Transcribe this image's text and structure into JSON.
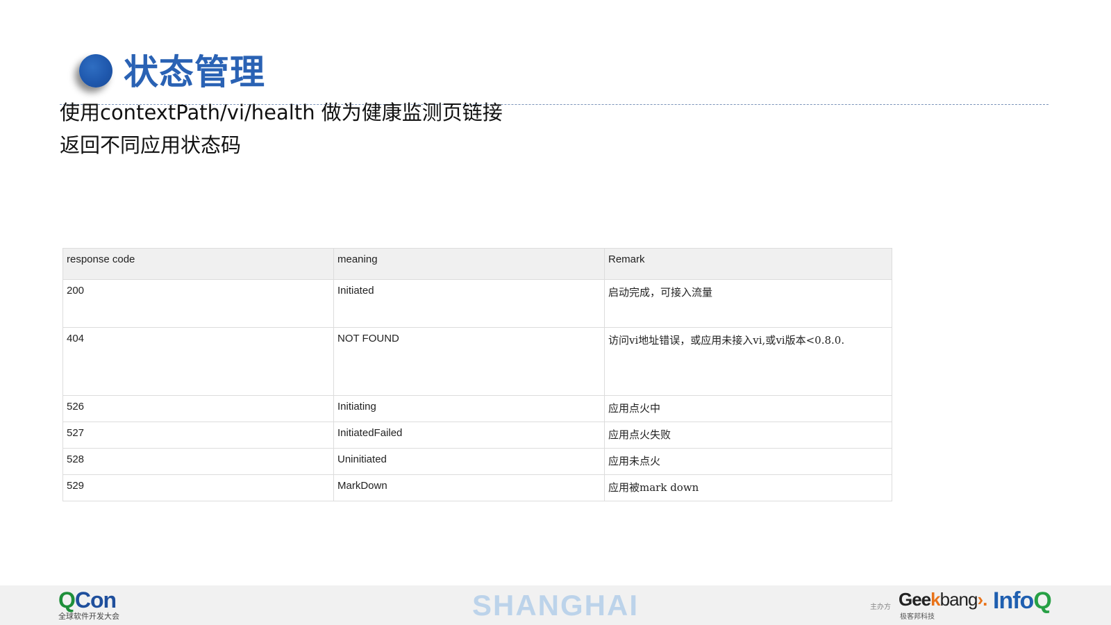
{
  "slide": {
    "title": "状态管理",
    "lines": [
      "使用contextPath/vi/health 做为健康监测页链接",
      "返回不同应用状态码"
    ]
  },
  "table": {
    "headers": [
      "response code",
      "meaning",
      "Remark"
    ],
    "rows": [
      {
        "code": "200",
        "meaning": "Initiated",
        "remark": "启动完成，可接入流量"
      },
      {
        "code": "404",
        "meaning": "NOT FOUND",
        "remark": "访问vi地址错误，或应用未接入vi,或vi版本<0.8.0."
      },
      {
        "code": "526",
        "meaning": "Initiating",
        "remark": "应用点火中"
      },
      {
        "code": "527",
        "meaning": "InitiatedFailed",
        "remark": "应用点火失败"
      },
      {
        "code": "528",
        "meaning": "Uninitiated",
        "remark": "应用未点火"
      },
      {
        "code": "529",
        "meaning": "MarkDown",
        "remark": "应用被mark down"
      }
    ]
  },
  "footer": {
    "qcon_q": "Q",
    "qcon_con": "Con",
    "qcon_subtitle": "全球软件开发大会",
    "city": "SHANGHAI",
    "host_label": "主办方",
    "geek": "Gee",
    "geek_k": "k",
    "geek_bang": "bang",
    "geek_arrow": "›.",
    "geek_subtitle": "极客邦科技",
    "infoq_info": "Info",
    "infoq_q": "Q"
  },
  "colors": {
    "title_blue": "#2a62b4",
    "qcon_green": "#1e8f3a",
    "geek_orange": "#e8731a"
  }
}
